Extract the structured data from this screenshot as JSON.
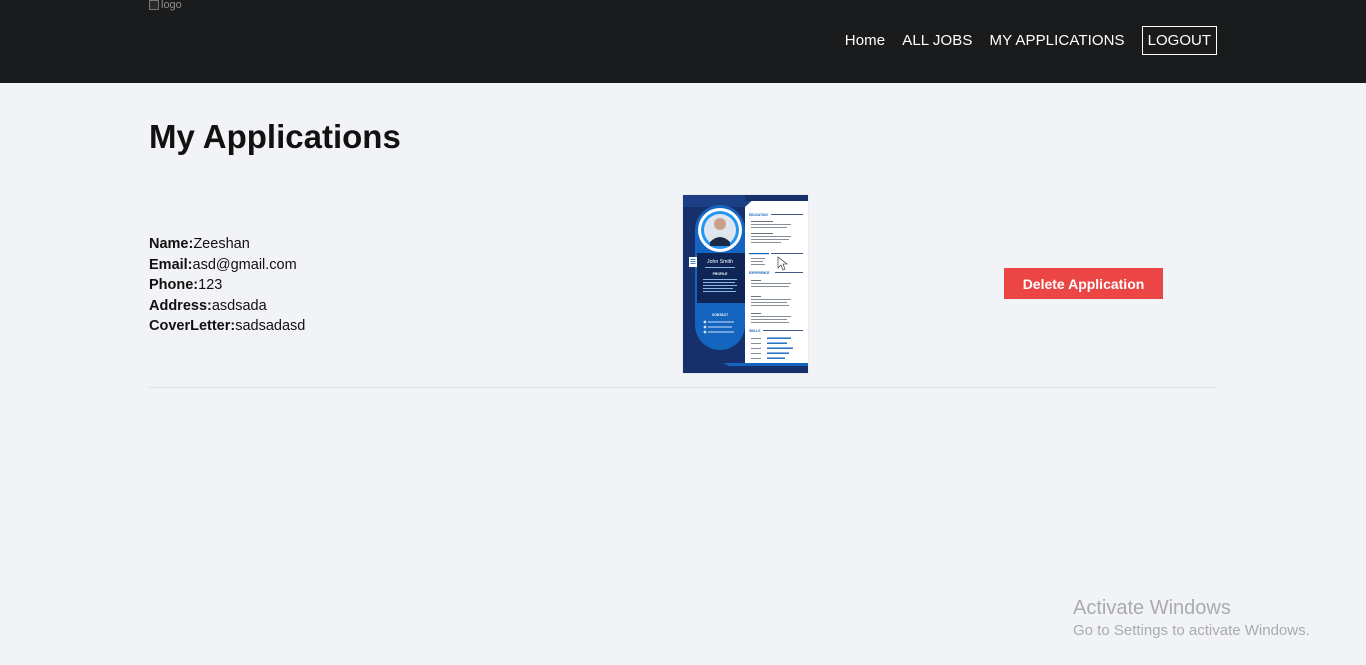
{
  "navbar": {
    "logo_alt": "logo",
    "links": [
      "Home",
      "ALL JOBS",
      "MY APPLICATIONS"
    ],
    "logout_label": "LOGOUT"
  },
  "page": {
    "title": "My Applications"
  },
  "application": {
    "fields": [
      {
        "label": "Name:",
        "value": "Zeeshan"
      },
      {
        "label": "Email:",
        "value": "asd@gmail.com"
      },
      {
        "label": "Phone:",
        "value": "123"
      },
      {
        "label": "Address:",
        "value": "asdsada"
      },
      {
        "label": "CoverLetter:",
        "value": "sadsadasd"
      }
    ],
    "resume": {
      "name": "John Smith",
      "sections": {
        "profile": "PROFILE",
        "contact": "CONTACT",
        "education": "EDUCATION",
        "experience": "EXPERIENCE",
        "skills": "SKILLS"
      }
    },
    "delete_label": "Delete Application"
  },
  "watermark": {
    "title": "Activate Windows",
    "subtitle": "Go to Settings to activate Windows."
  },
  "colors": {
    "navbar_bg": "#1a1b1c",
    "page_bg": "#f2f3f6",
    "delete_button": "#eb4545",
    "resume_blue": "#1565c0"
  }
}
